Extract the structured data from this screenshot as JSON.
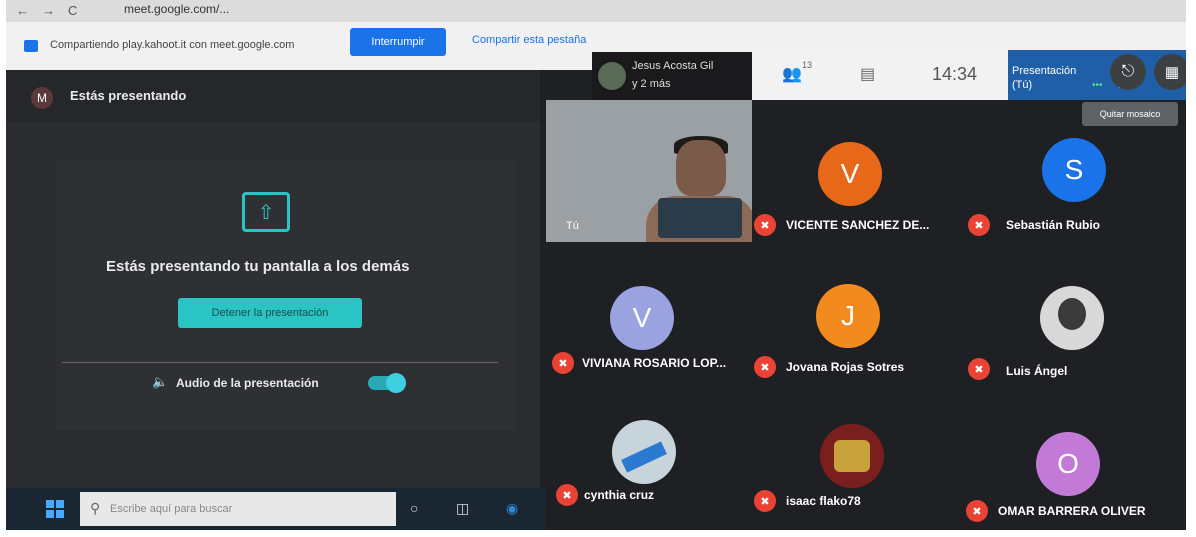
{
  "browser": {
    "nav": [
      "←",
      "→",
      "C"
    ],
    "url": "meet.google.com/..."
  },
  "share_bar": {
    "message": "Compartiendo play.kahoot.it con meet.google.com",
    "interrupt_label": "Interrumpir",
    "share_tab_label": "Compartir esta pestaña"
  },
  "left_panel": {
    "avatar_letter": "M",
    "header": "Estás presentando",
    "present_title": "Estás presentando tu pantalla a los demás",
    "stop_button": "Detener la presentación",
    "audio_label": "Audio de la presentación",
    "audio_on": true
  },
  "call_bar": {
    "presenter_line1": "Jesus Acosta Gil",
    "presenter_line2": "y 2 más",
    "people_count": "13",
    "time": "14:34",
    "presentation_label": "Presentación",
    "presentation_you": "(Tú)",
    "you_short": "Tú",
    "tooltip": "Quitar mosaico"
  },
  "self_tile": {
    "label": "Tú"
  },
  "participants": [
    {
      "name": "VICENTE SANCHEZ DE...",
      "letter": "V",
      "color": "#e8681a"
    },
    {
      "name": "Sebastián Rubio",
      "letter": "S",
      "color": "#1a73e8"
    },
    {
      "name": "VIVIANA ROSARIO LOP...",
      "letter": "V",
      "color": "#9aa2e0"
    },
    {
      "name": "Jovana Rojas Sotres",
      "letter": "J",
      "color": "#f28a1e"
    },
    {
      "name": "Luis Ángel",
      "letter": "",
      "color": "#d8d8d8"
    },
    {
      "name": "cynthia cruz",
      "letter": "",
      "color": "#c8d4dc"
    },
    {
      "name": "isaac flako78",
      "letter": "",
      "color": "#7a1e1e"
    },
    {
      "name": "OMAR BARRERA OLIVER",
      "letter": "O",
      "color": "#c27ad6"
    }
  ],
  "taskbar": {
    "search_placeholder": "Escribe aquí para buscar"
  }
}
